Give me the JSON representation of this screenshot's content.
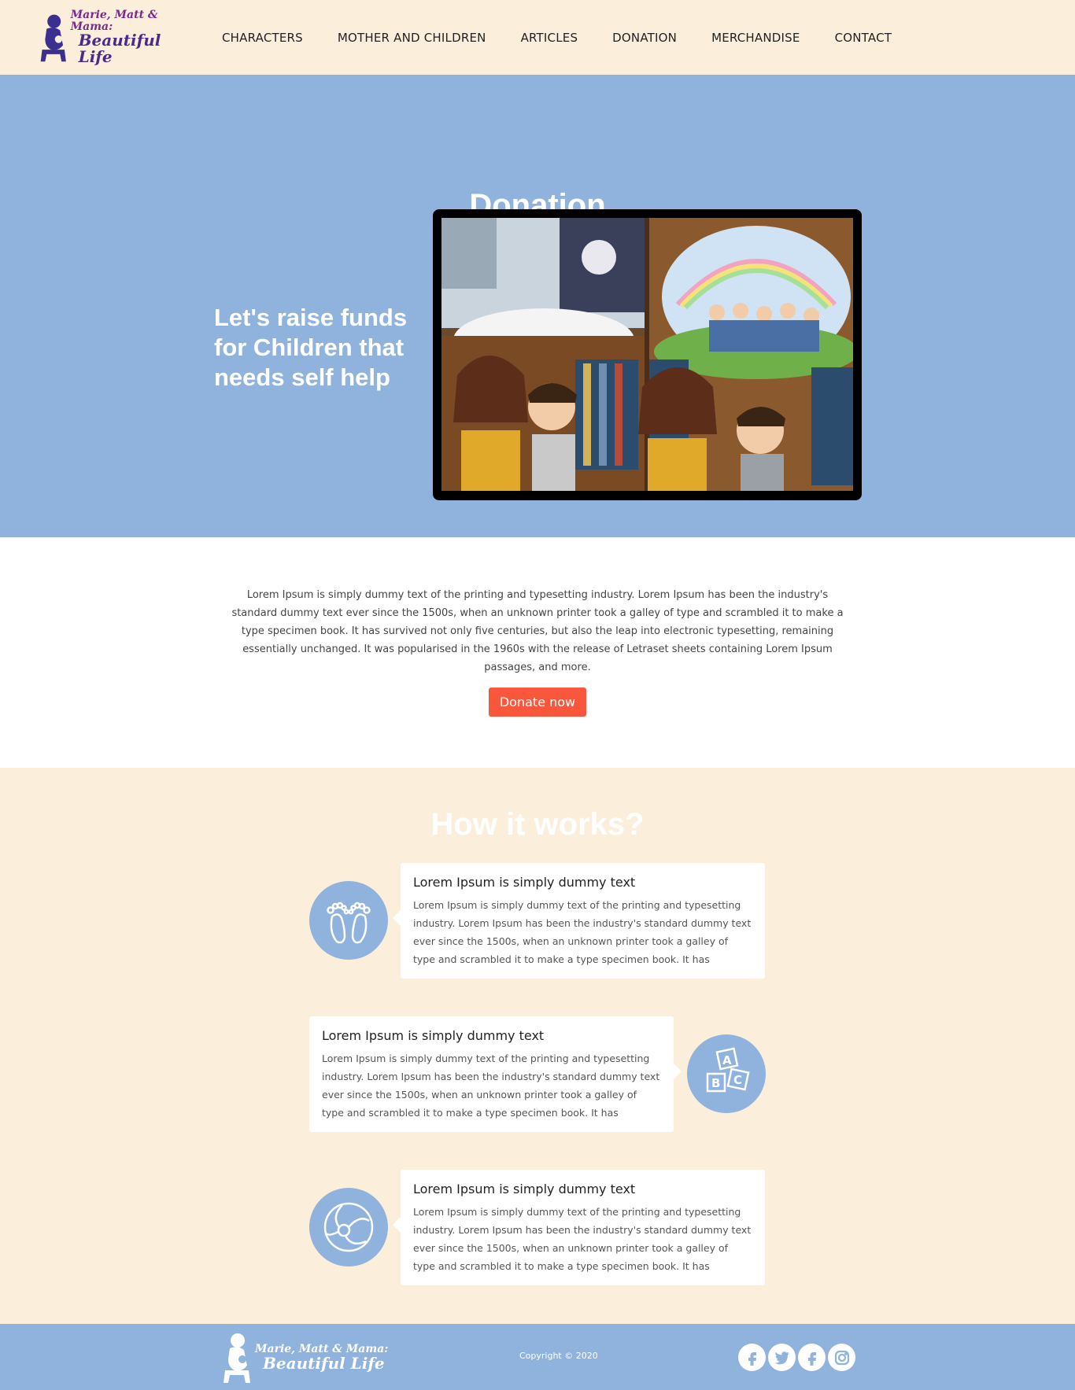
{
  "brand": {
    "line1": "Marie, Matt & Mama:",
    "line2": "Beautiful Life"
  },
  "nav": {
    "items": [
      "CHARACTERS",
      "MOTHER AND CHILDREN",
      "ARTICLES",
      "DONATION",
      "MERCHANDISE",
      "CONTACT"
    ]
  },
  "hero": {
    "title": "Donation",
    "tagline": "Let's raise funds for Children that needs self help",
    "image_alt": "illustrated-book-spread"
  },
  "intro": {
    "text": "Lorem Ipsum is simply dummy text of the printing and typesetting industry. Lorem Ipsum has been the industry's standard dummy text ever since the 1500s, when an unknown printer took a galley of type and scrambled it to make a type specimen book. It has survived not only five centuries, but also the leap into electronic typesetting, remaining essentially unchanged. It was popularised in the 1960s with the release of Letraset sheets containing Lorem Ipsum passages, and more.",
    "button_label": "Donate now"
  },
  "how": {
    "title": "How it works?",
    "steps": [
      {
        "heading": "Lorem Ipsum is simply dummy text",
        "body": "Lorem Ipsum is simply dummy text of the printing and typesetting industry. Lorem Ipsum has been the industry's standard dummy text ever since the 1500s, when an unknown printer took a galley of type and scrambled it to make a type specimen book. It has",
        "icon": "baby-feet-icon"
      },
      {
        "heading": "Lorem Ipsum is simply dummy text",
        "body": "Lorem Ipsum is simply dummy text of the printing and typesetting industry. Lorem Ipsum has been the industry's standard dummy text ever since the 1500s, when an unknown printer took a galley of type and scrambled it to make a type specimen book. It has",
        "icon": "abc-blocks-icon"
      },
      {
        "heading": "Lorem Ipsum is simply dummy text",
        "body": "Lorem Ipsum is simply dummy text of the printing and typesetting industry. Lorem Ipsum has been the industry's standard dummy text ever since the 1500s, when an unknown printer took a galley of type and scrambled it to make a type specimen book. It has",
        "icon": "beach-ball-icon"
      }
    ]
  },
  "footer": {
    "copyright": "Copyright © 2020",
    "socials": [
      "facebook-icon",
      "twitter-icon",
      "facebook-icon",
      "instagram-icon"
    ]
  },
  "colors": {
    "header_bg": "#fbefdc",
    "hero_bg": "#8fb3dc",
    "accent_button": "#f9573c",
    "footer_bg": "#8fb3dc"
  }
}
